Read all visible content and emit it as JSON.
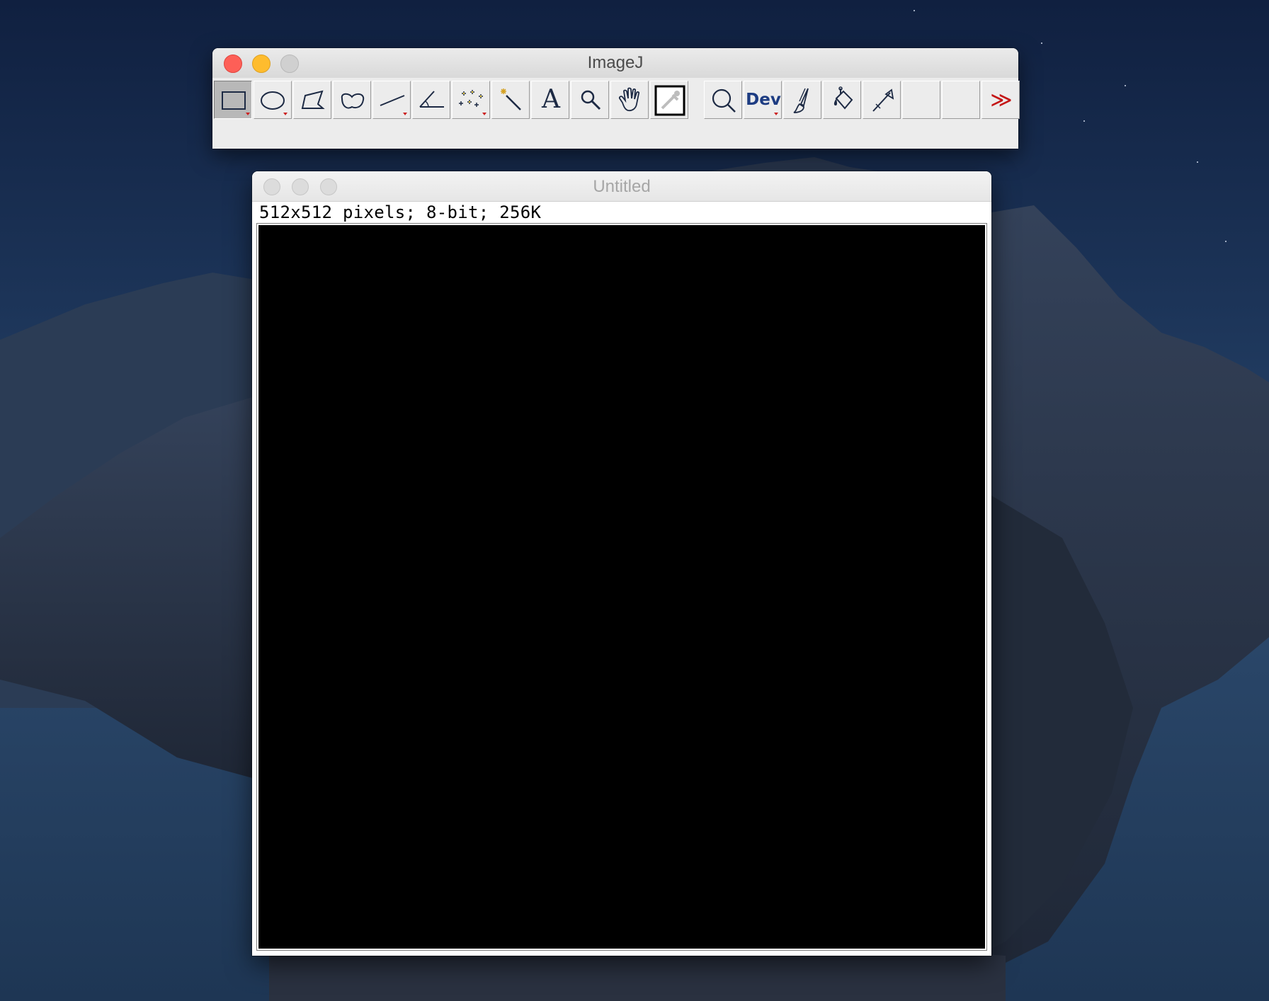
{
  "toolbar_window": {
    "title": "ImageJ",
    "tools": [
      {
        "name": "rectangle-tool",
        "icon": "rectangle-icon"
      },
      {
        "name": "oval-tool",
        "icon": "oval-icon"
      },
      {
        "name": "polygon-tool",
        "icon": "polygon-icon"
      },
      {
        "name": "freehand-tool",
        "icon": "freehand-icon"
      },
      {
        "name": "line-tool",
        "icon": "line-icon"
      },
      {
        "name": "angle-tool",
        "icon": "angle-icon"
      },
      {
        "name": "multipoint-tool",
        "icon": "multipoint-icon"
      },
      {
        "name": "wand-tool",
        "icon": "wand-icon"
      },
      {
        "name": "text-tool",
        "icon": "text-icon",
        "label": "A"
      },
      {
        "name": "magnifier-tool",
        "icon": "magnifier-icon"
      },
      {
        "name": "hand-tool",
        "icon": "hand-icon"
      },
      {
        "name": "color-picker-tool",
        "icon": "color-picker-icon"
      },
      {
        "name": "zoom-tool",
        "icon": "zoom-icon"
      },
      {
        "name": "dev-menu-tool",
        "icon": "dev-icon",
        "label": "Dev"
      },
      {
        "name": "brush-tool",
        "icon": "brush-icon"
      },
      {
        "name": "flood-fill-tool",
        "icon": "flood-fill-icon"
      },
      {
        "name": "pencil-tool",
        "icon": "pencil-icon"
      },
      {
        "name": "empty-slot-1",
        "icon": ""
      },
      {
        "name": "empty-slot-2",
        "icon": ""
      },
      {
        "name": "more-tools-switch",
        "icon": "double-chevron-right-icon",
        "label": "≫"
      }
    ],
    "selected_tool": "rectangle-tool",
    "colors": {
      "dropdown_marker": "#cc2222",
      "icon_stroke": "#1d2a44",
      "dev_text": "#1d3c82",
      "more_tools": "#c41616"
    }
  },
  "image_window": {
    "title": "Untitled",
    "info": "512x512 pixels; 8-bit; 256K",
    "canvas_color": "#000000"
  }
}
